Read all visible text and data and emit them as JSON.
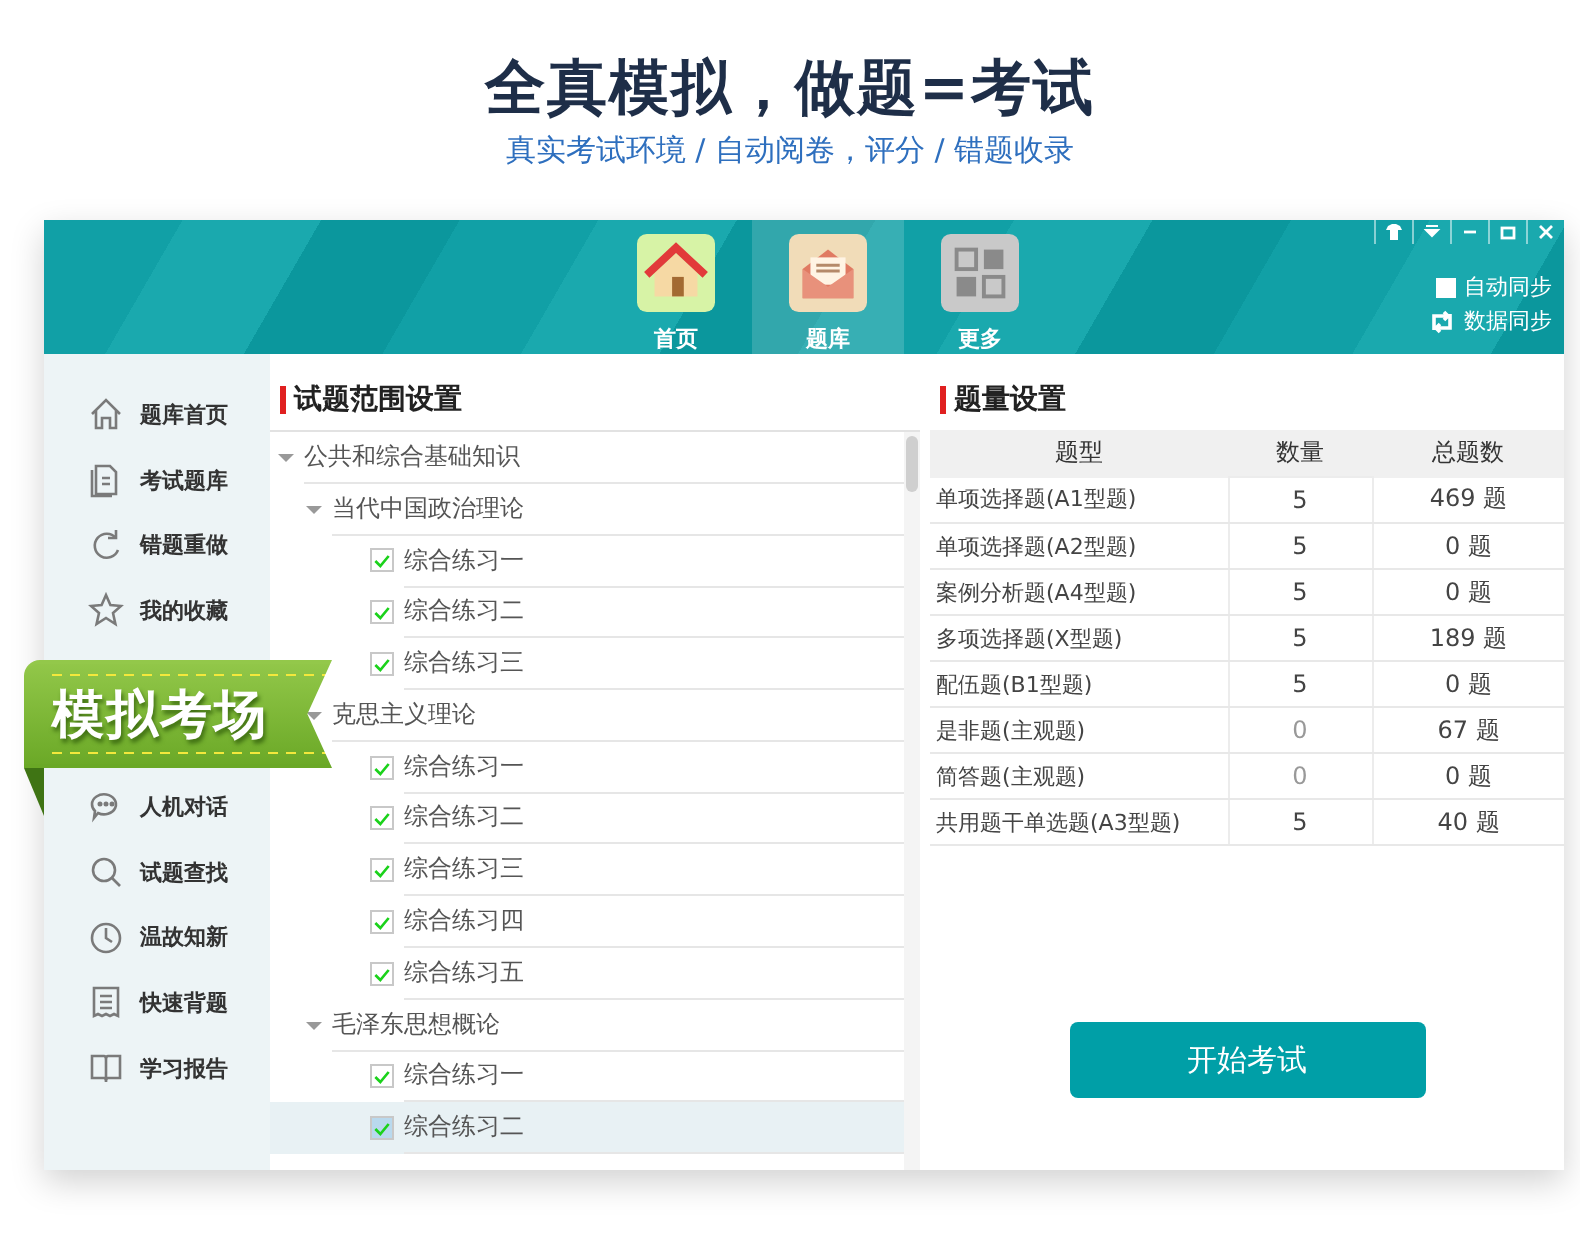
{
  "heading": {
    "title": "全真模拟，做题=考试",
    "subtitle": "真实考试环境 / 自动阅卷，评分 / 错题收录"
  },
  "nav": [
    {
      "label": "首页",
      "selected": false
    },
    {
      "label": "题库",
      "selected": true
    },
    {
      "label": "更多",
      "selected": false
    }
  ],
  "sync": {
    "auto": {
      "label": "自动同步",
      "checked": false
    },
    "manual": "数据同步"
  },
  "sidebar": {
    "top": [
      {
        "label": "题库首页"
      },
      {
        "label": "考试题库"
      },
      {
        "label": "错题重做"
      },
      {
        "label": "我的收藏"
      }
    ],
    "bottom": [
      {
        "label": "人机对话"
      },
      {
        "label": "试题查找"
      },
      {
        "label": "温故知新"
      },
      {
        "label": "快速背题"
      },
      {
        "label": "学习报告"
      }
    ]
  },
  "banner": "模拟考场",
  "scope": {
    "title": "试题范围设置",
    "tree": [
      {
        "label": "公共和综合基础知识",
        "expanded": true,
        "children": [
          {
            "label": "当代中国政治理论",
            "expanded": true,
            "children": [
              {
                "label": "综合练习一",
                "checked": true,
                "selected": false
              },
              {
                "label": "综合练习二",
                "checked": true,
                "selected": false
              },
              {
                "label": "综合练习三",
                "checked": true,
                "selected": false
              }
            ]
          },
          {
            "label": "克思主义理论",
            "expanded": true,
            "children": [
              {
                "label": "综合练习一",
                "checked": true,
                "selected": false
              },
              {
                "label": "综合练习二",
                "checked": true,
                "selected": false
              },
              {
                "label": "综合练习三",
                "checked": true,
                "selected": false
              },
              {
                "label": "综合练习四",
                "checked": true,
                "selected": false
              },
              {
                "label": "综合练习五",
                "checked": true,
                "selected": false
              }
            ]
          },
          {
            "label": "毛泽东思想概论",
            "expanded": true,
            "children": [
              {
                "label": "综合练习一",
                "checked": true,
                "selected": false
              },
              {
                "label": "综合练习二",
                "checked": true,
                "selected": true
              }
            ]
          }
        ]
      }
    ]
  },
  "quota": {
    "title": "题量设置",
    "columns": [
      "题型",
      "数量",
      "总题数"
    ],
    "rows": [
      {
        "type": "单项选择题(A1型题)",
        "count": "5",
        "total": "469 题",
        "disabled": false
      },
      {
        "type": "单项选择题(A2型题)",
        "count": "5",
        "total": "0 题",
        "disabled": false
      },
      {
        "type": "案例分析题(A4型题)",
        "count": "5",
        "total": "0 题",
        "disabled": false
      },
      {
        "type": "多项选择题(X型题)",
        "count": "5",
        "total": "189 题",
        "disabled": false
      },
      {
        "type": "配伍题(B1型题)",
        "count": "5",
        "total": "0 题",
        "disabled": false
      },
      {
        "type": "是非题(主观题)",
        "count": "0",
        "total": "67 题",
        "disabled": true
      },
      {
        "type": "简答题(主观题)",
        "count": "0",
        "total": "0 题",
        "disabled": true
      },
      {
        "type": "共用题干单选题(A3型题)",
        "count": "5",
        "total": "40 题",
        "disabled": false
      }
    ]
  },
  "start_button": "开始考试"
}
